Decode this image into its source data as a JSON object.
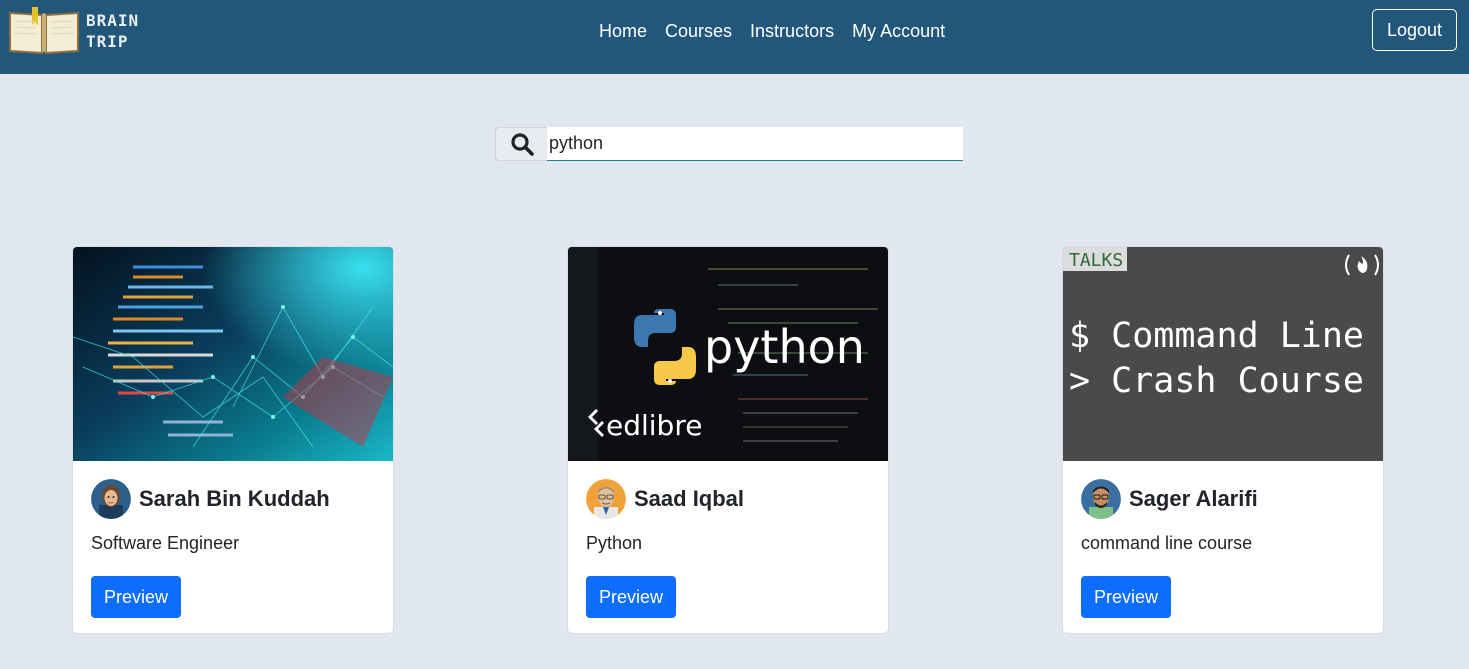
{
  "brand": {
    "line1": "BRAIN",
    "line2": "TRIP",
    "logo_icon": "open-book-icon"
  },
  "nav": {
    "links": [
      "Home",
      "Courses",
      "Instructors",
      "My Account"
    ],
    "logout_label": "Logout"
  },
  "search": {
    "value": "python",
    "icon": "search-icon"
  },
  "courses": [
    {
      "author": "Sarah Bin Kuddah",
      "title": "Software Engineer",
      "preview_label": "Preview",
      "image": "abstract-code-network"
    },
    {
      "author": "Saad Iqbal",
      "title": "Python",
      "preview_label": "Preview",
      "image_brand_main": "python",
      "image_brand_sub": "edlibre"
    },
    {
      "author": "Sager Alarifi",
      "title": "command line course",
      "preview_label": "Preview",
      "image_tag": "TALKS",
      "image_line1": "$ Command Line \\",
      "image_line2": "> Crash Course"
    }
  ],
  "colors": {
    "navbar": "#22567a",
    "background": "#e1e7ef",
    "primary": "#0d6efd"
  }
}
